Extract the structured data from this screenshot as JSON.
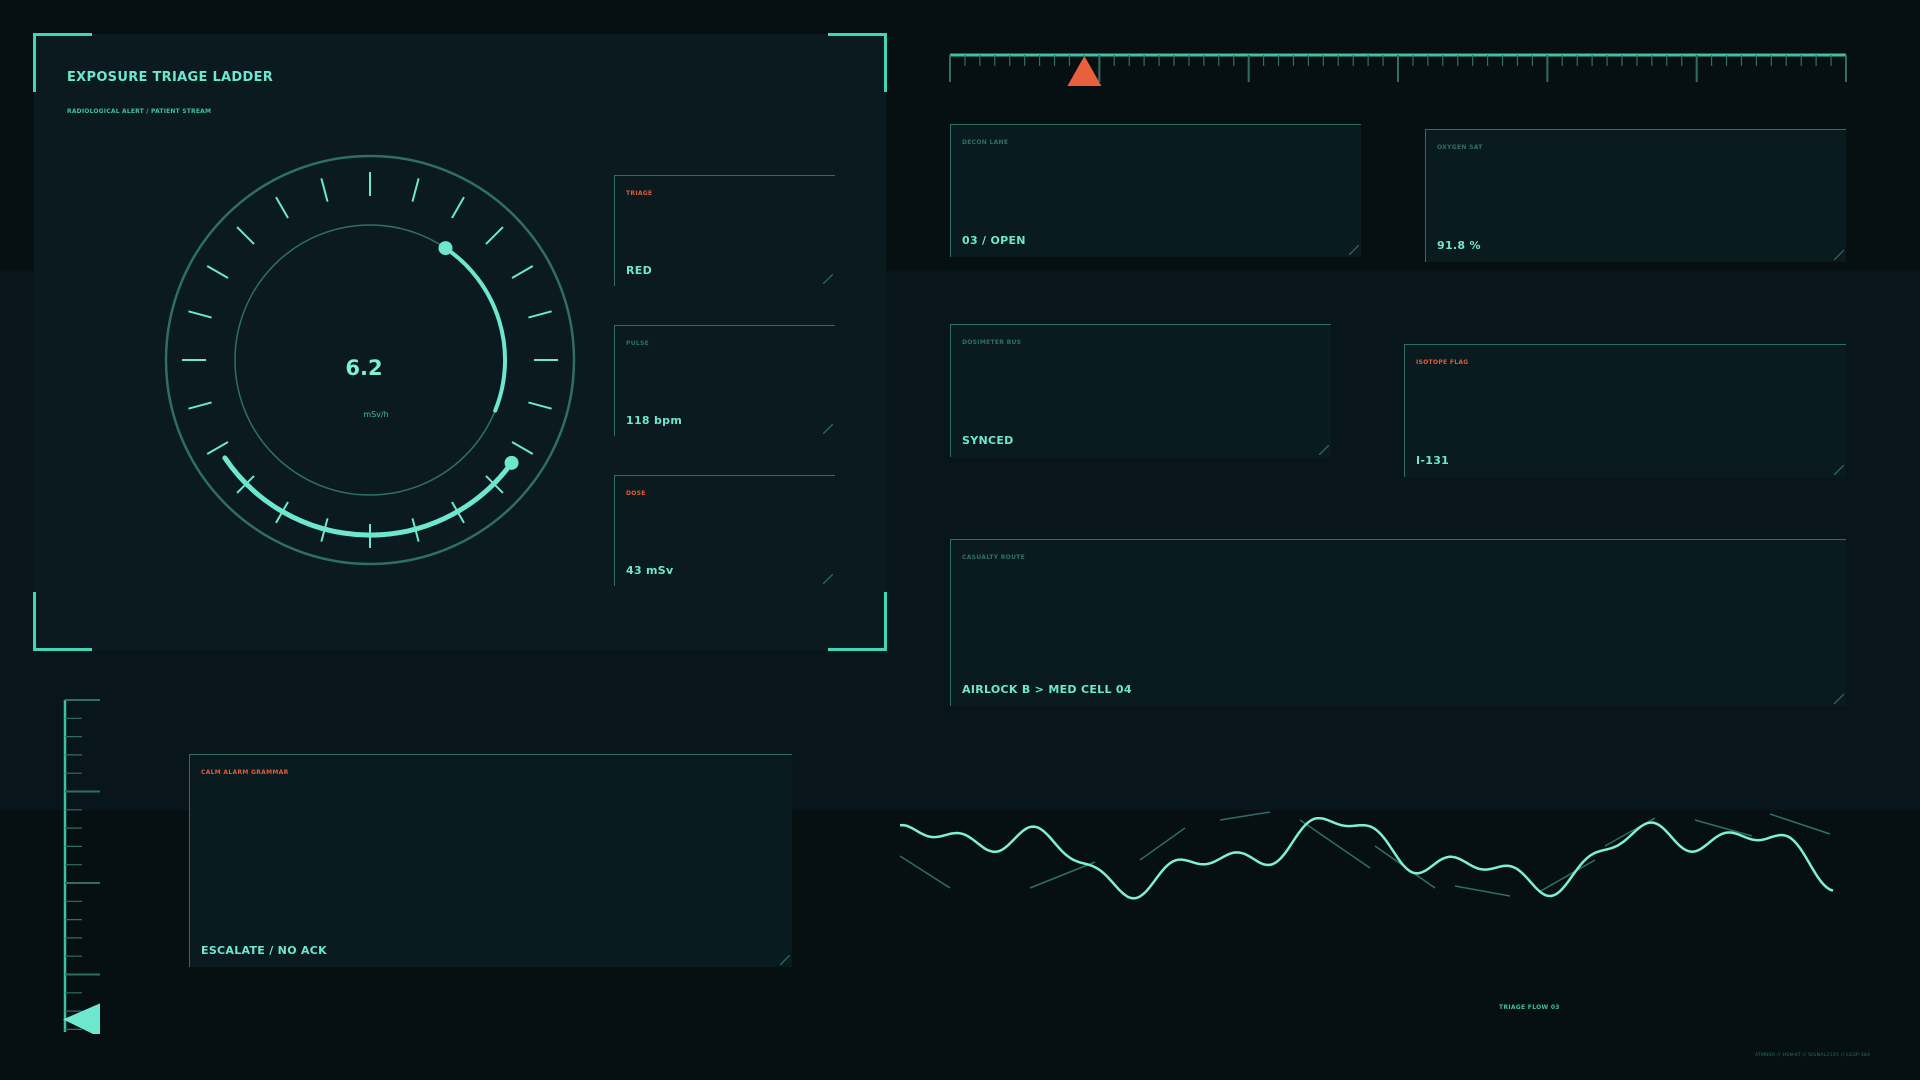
{
  "panel": {
    "title": "EXPOSURE TRIAGE LADDER",
    "subtitle": "RADIOLOGICAL ALERT / PATIENT STREAM"
  },
  "gauge": {
    "value": "6.2",
    "unit": "mSv/h"
  },
  "readouts": [
    {
      "label": "TRIAGE",
      "value": "RED",
      "alert": true
    },
    {
      "label": "PULSE",
      "value": "118 bpm",
      "alert": false
    },
    {
      "label": "DOSE",
      "value": "43 mSv",
      "alert": true
    }
  ],
  "status_cards": {
    "decon": {
      "label": "DECON LANE",
      "value": "03 / OPEN"
    },
    "oxygen": {
      "label": "OXYGEN SAT",
      "value": "91.8 %"
    },
    "dosimeter": {
      "label": "DOSIMETER BUS",
      "value": "SYNCED"
    },
    "isotope": {
      "label": "ISOTOPE FLAG",
      "value": "I-131"
    },
    "route": {
      "label": "CASUALTY ROUTE",
      "value": "AIRLOCK B > MED CELL 04"
    },
    "alarm": {
      "label": "CALM ALARM GRAMMAR",
      "value": "ESCALATE / NO ACK"
    }
  },
  "timeline": {
    "marker_fraction": 0.15
  },
  "vertical_scale": {
    "marker_fraction": 0.98
  },
  "waveform": {
    "label": "TRIAGE FLOW 03"
  },
  "footer": {
    "meta": "ATMNSR // HSN-KT // SIGNAL2145 // LGSP-384"
  },
  "colors": {
    "accent": "#6de8cf",
    "line": "#2f6f63",
    "alert": "#e05c3a",
    "background": "#061013"
  }
}
